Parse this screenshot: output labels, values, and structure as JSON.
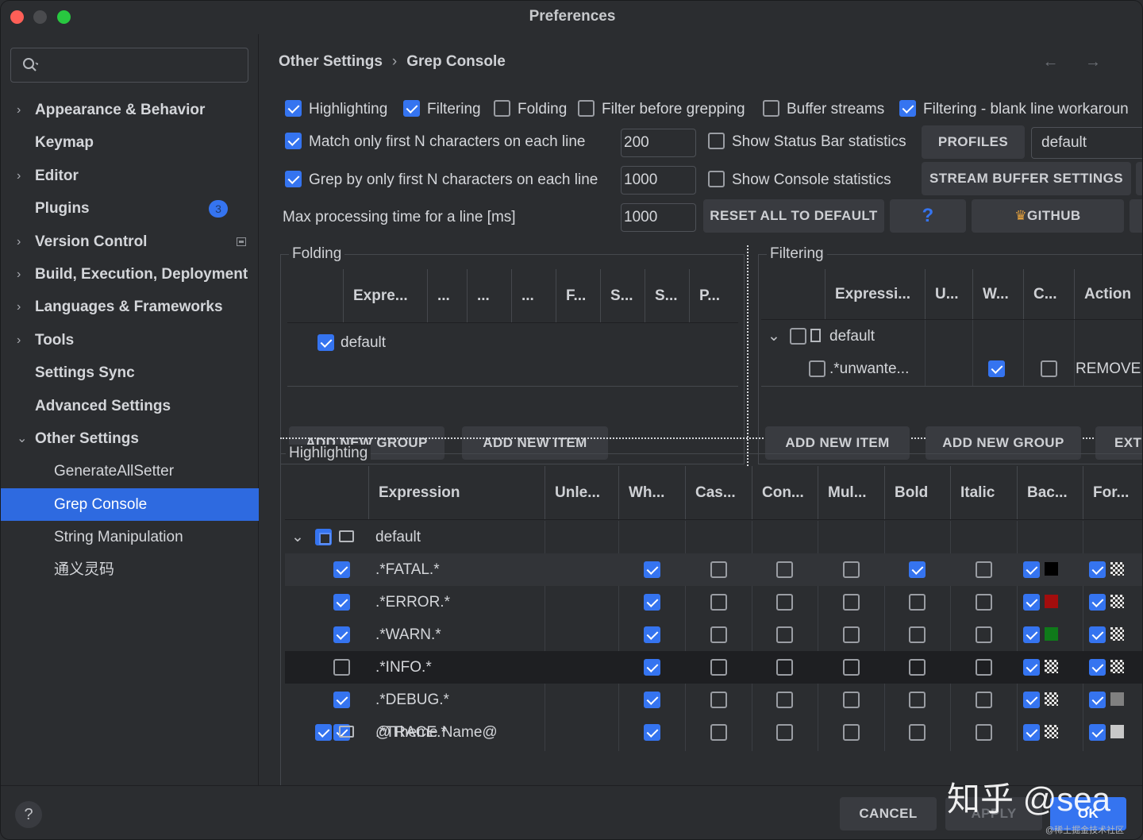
{
  "window": {
    "title": "Preferences"
  },
  "sidebar": {
    "search_placeholder": "",
    "items": [
      {
        "label": "Appearance & Behavior",
        "chevron": "›"
      },
      {
        "label": "Keymap",
        "chevron": ""
      },
      {
        "label": "Editor",
        "chevron": "›"
      },
      {
        "label": "Plugins",
        "chevron": "",
        "badge": "3"
      },
      {
        "label": "Version Control",
        "chevron": "›"
      },
      {
        "label": "Build, Execution, Deployment",
        "chevron": "›"
      },
      {
        "label": "Languages & Frameworks",
        "chevron": "›"
      },
      {
        "label": "Tools",
        "chevron": "›"
      },
      {
        "label": "Settings Sync",
        "chevron": ""
      },
      {
        "label": "Advanced Settings",
        "chevron": ""
      },
      {
        "label": "Other Settings",
        "chevron": "⌄"
      },
      {
        "label": "GenerateAllSetter"
      },
      {
        "label": "Grep Console"
      },
      {
        "label": "String Manipulation"
      },
      {
        "label": "通义灵码"
      }
    ]
  },
  "breadcrumb": {
    "parent": "Other Settings",
    "sep": "›",
    "current": "Grep Console",
    "nav": "← →"
  },
  "options": {
    "highlighting": "Highlighting",
    "filtering": "Filtering",
    "folding": "Folding",
    "filter_before": "Filter before grepping",
    "buffer_streams": "Buffer streams",
    "blank_line": "Filtering - blank line workaroun",
    "match_first_n": "Match only first N characters on each line",
    "match_first_n_value": "200",
    "grep_first_n": "Grep by only first N characters on each line",
    "grep_first_n_value": "1000",
    "max_time": "Max processing time for a line [ms]",
    "max_time_value": "1000",
    "status_bar": "Show Status Bar statistics",
    "console_stats": "Show Console statistics",
    "profile_value": "default"
  },
  "buttons": {
    "profiles": "PROFILES",
    "stream_buffer": "STREAM BUFFER SETTINGS",
    "reset": "RESET ALL TO DEFAULT",
    "help": "?",
    "github": "GITHUB",
    "add_group": "ADD NEW GROUP",
    "add_item": "ADD NEW ITEM",
    "ext": "EXT",
    "cancel": "CANCEL",
    "apply": "APPLY",
    "ok": "OK",
    "help_circle": "?"
  },
  "folding": {
    "title": "Folding",
    "columns": [
      "Expre...",
      "...",
      "...",
      "...",
      "F...",
      "S...",
      "S...",
      "P..."
    ],
    "row": "default"
  },
  "filtering": {
    "title": "Filtering",
    "columns": [
      "Expressi...",
      "U...",
      "W...",
      "C...",
      "Action"
    ],
    "group": "default",
    "item": ".*unwante...",
    "action": "REMOVE"
  },
  "highlighting": {
    "title": "Highlighting",
    "columns": [
      "Expression",
      "Unle...",
      "Wh...",
      "Cas...",
      "Con...",
      "Mul...",
      "Bold",
      "Italic",
      "Bac...",
      "For..."
    ],
    "group": "default",
    "rows": [
      {
        "expr": ".*FATAL.*",
        "on": true,
        "wh": true,
        "bold": true,
        "bg": "#000000",
        "fg": "checker"
      },
      {
        "expr": ".*ERROR.*",
        "on": true,
        "wh": true,
        "bold": false,
        "bg": "#a30d0d",
        "fg": "checker"
      },
      {
        "expr": ".*WARN.*",
        "on": true,
        "wh": true,
        "bold": false,
        "bg": "#0f7a1a",
        "fg": "checker"
      },
      {
        "expr": ".*INFO.*",
        "on": false,
        "wh": true,
        "bold": false,
        "bg": "checker",
        "fg": "checker"
      },
      {
        "expr": ".*DEBUG.*",
        "on": true,
        "wh": true,
        "bold": false,
        "bg": "checker",
        "fg": "#808080"
      },
      {
        "expr": ".*TRACE.*",
        "on": true,
        "wh": true,
        "bold": false,
        "bg": "checker",
        "fg": "#c8c8c8"
      }
    ],
    "theme_group": "@Theme Name@"
  },
  "watermark": {
    "main": "知乎 @sea",
    "sub": "@稀土掘金技术社区"
  },
  "colors": {
    "accent": "#3574f0",
    "selection": "#2e6ae0",
    "background": "#2b2d30"
  }
}
